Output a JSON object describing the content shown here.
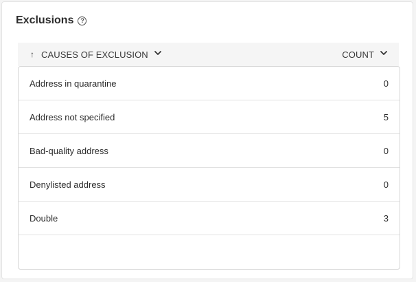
{
  "widget": {
    "title": "Exclusions",
    "help_icon": "?"
  },
  "table": {
    "columns": {
      "cause": "CAUSES OF EXCLUSION",
      "count": "COUNT"
    },
    "sort_icon": "↑",
    "rows": [
      {
        "cause": "Address in quarantine",
        "count": "0"
      },
      {
        "cause": "Address not specified",
        "count": "5"
      },
      {
        "cause": "Bad-quality address",
        "count": "0"
      },
      {
        "cause": "Denylisted address",
        "count": "0"
      },
      {
        "cause": "Double",
        "count": "3"
      }
    ]
  }
}
